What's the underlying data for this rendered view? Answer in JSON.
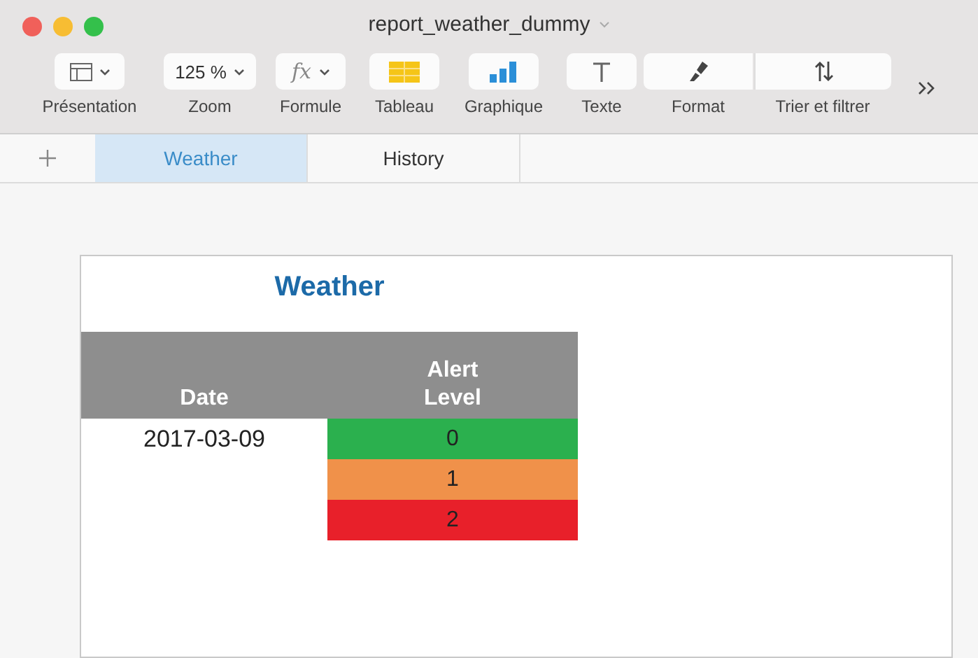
{
  "window": {
    "title": "report_weather_dummy"
  },
  "toolbar": [
    {
      "kind": "layout",
      "label": "Présentation"
    },
    {
      "kind": "zoom",
      "value": "125 %",
      "label": "Zoom"
    },
    {
      "kind": "formula",
      "value": "fx",
      "label": "Formule"
    },
    {
      "kind": "table",
      "label": "Tableau"
    },
    {
      "kind": "chart",
      "label": "Graphique"
    },
    {
      "kind": "text",
      "label": "Texte"
    },
    {
      "kind": "format",
      "label": "Format"
    },
    {
      "kind": "sort",
      "label": "Trier et filtrer"
    }
  ],
  "tabs": [
    {
      "label": "Weather",
      "selected": true
    },
    {
      "label": "History",
      "selected": false
    }
  ],
  "sheet": {
    "title": "Weather",
    "columns": [
      "Date",
      "Alert Level"
    ],
    "rows": [
      {
        "date": "2017-03-09",
        "level": "0",
        "color": "#2bb04e"
      },
      {
        "level": "1",
        "color": "#f0914a"
      },
      {
        "level": "2",
        "color": "#e8202a"
      }
    ]
  }
}
